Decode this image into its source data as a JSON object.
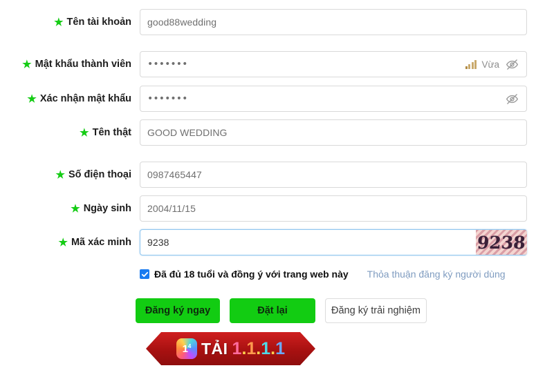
{
  "form": {
    "rows": [
      {
        "label": "Tên tài khoản",
        "value": "good88wedding",
        "name": "username",
        "type": "text"
      },
      {
        "label": "Mật khẩu thành viên",
        "value": "•••••••",
        "name": "member-password",
        "type": "password",
        "strength": "Vừa"
      },
      {
        "label": "Xác nhận mật khẩu",
        "value": "•••••••",
        "name": "confirm-password",
        "type": "password"
      },
      {
        "label": "Tên thật",
        "value": "GOOD WEDDING",
        "name": "real-name",
        "type": "text"
      },
      {
        "label": "Số điện thoại",
        "value": "0987465447",
        "name": "phone-number",
        "type": "text"
      },
      {
        "label": "Ngày sinh",
        "value": "2004/11/15",
        "name": "birth-date",
        "type": "text"
      },
      {
        "label": "Mã xác minh",
        "value": "9238",
        "name": "verification-code",
        "type": "text"
      }
    ],
    "star_icon": "star-icon",
    "eye_icon": "eye-slash-icon",
    "strength_icon": "signal-bars-icon",
    "captcha": {
      "text": "9238",
      "icon": "captcha-image"
    }
  },
  "agreement": {
    "checkbox_checked": true,
    "text": "Đã đủ 18 tuổi và đồng ý với trang web này",
    "link": "Thỏa thuận đăng ký người dùng"
  },
  "buttons": {
    "register": "Đăng ký ngay",
    "reset": "Đặt lại",
    "trial": "Đăng ký trải nghiệm"
  },
  "banner": {
    "icon_glyph": "1",
    "icon_sup": "4",
    "word": "TẢI",
    "numbers": [
      "1",
      "1",
      "1",
      "1"
    ],
    "separator": "."
  },
  "colors": {
    "accent_green": "#12cc12",
    "star_green": "#15cc15",
    "focus_blue": "#8ec5ef",
    "checkbox_blue": "#1a7bf0",
    "link_blue": "#7f9cc0",
    "banner_red": "#b01414",
    "banner_gold": "#f0b32a"
  }
}
